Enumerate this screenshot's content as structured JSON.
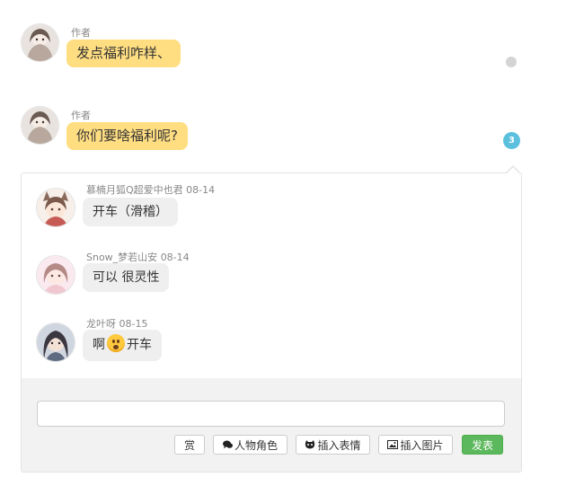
{
  "messages": [
    {
      "author": "作者",
      "text": "发点福利咋样、"
    },
    {
      "author": "作者",
      "text": "你们要啥福利呢?",
      "reply_count": "3"
    }
  ],
  "replies": [
    {
      "user": "慕楠月狐Q超爱中也君",
      "date": "08-14",
      "text": "开车（滑稽）"
    },
    {
      "user": "Snow_梦若山安",
      "date": "08-14",
      "text": "可以 很灵性"
    },
    {
      "user": "龙叶呀",
      "date": "08-15",
      "text_before": "啊",
      "emoji": "astonished-face-emoji",
      "text_after": "开车"
    }
  ],
  "composer": {
    "input_value": "",
    "reward_label": "赏",
    "character_label": "人物角色",
    "emoji_label": "插入表情",
    "image_label": "插入图片",
    "send_label": "发表"
  },
  "icons": {
    "character": "speech-bubbles-icon",
    "emoji": "face-icon",
    "image": "picture-icon"
  },
  "colors": {
    "author_bubble": "#ffde82",
    "reply_bubble": "#efefef",
    "badge": "#5bc0de",
    "send_button": "#5cb85c"
  }
}
